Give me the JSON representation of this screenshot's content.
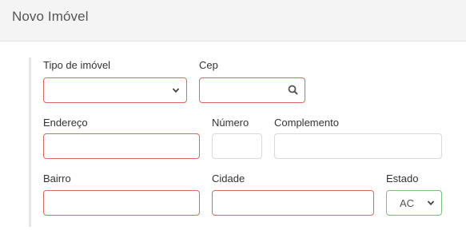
{
  "header": {
    "title": "Novo Imóvel"
  },
  "form": {
    "tipo": {
      "label": "Tipo de imóvel",
      "value": ""
    },
    "cep": {
      "label": "Cep",
      "value": "",
      "icon": "search-icon"
    },
    "endereco": {
      "label": "Endereço",
      "value": ""
    },
    "numero": {
      "label": "Número",
      "value": ""
    },
    "complemento": {
      "label": "Complemento",
      "value": ""
    },
    "bairro": {
      "label": "Bairro",
      "value": ""
    },
    "cidade": {
      "label": "Cidade",
      "value": ""
    },
    "estado": {
      "label": "Estado",
      "value": "AC"
    }
  },
  "colors": {
    "invalid_border": "#d9695f",
    "valid_border": "#7fbf7f",
    "header_bg": "#f4f4f4"
  }
}
